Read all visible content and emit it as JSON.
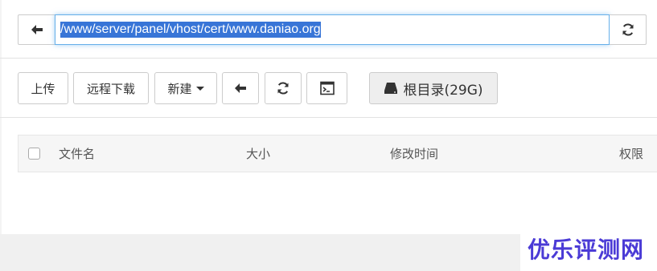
{
  "address_bar": {
    "path": "/www/server/panel/vhost/cert/www.daniao.org"
  },
  "toolbar": {
    "upload_label": "上传",
    "remote_download_label": "远程下载",
    "new_label": "新建",
    "root_label": "根目录(29G)"
  },
  "table": {
    "columns": [
      "文件名",
      "大小",
      "修改时间",
      "权限"
    ]
  },
  "watermark": "优乐评测网",
  "colors": {
    "selection": "#3875d7",
    "focus_border": "#66afe9",
    "watermark": "#4b3bd6"
  }
}
